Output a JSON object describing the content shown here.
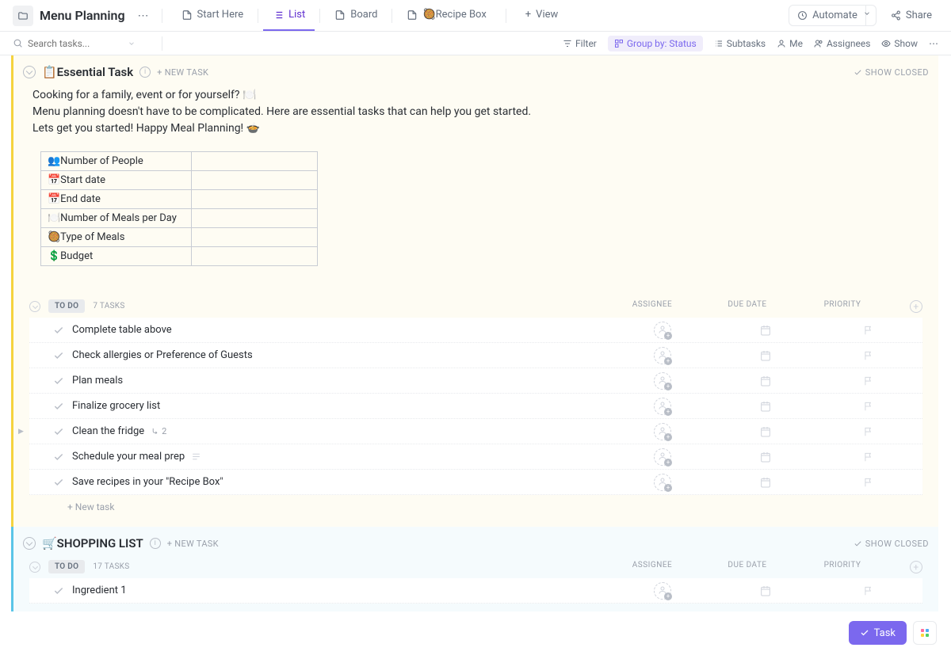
{
  "header": {
    "title": "Menu Planning",
    "tabs": [
      {
        "label": "Start Here",
        "icon": "doc"
      },
      {
        "label": "List",
        "icon": "list",
        "active": true
      },
      {
        "label": "Board",
        "icon": "doc"
      },
      {
        "label": "🥘Recipe Box",
        "icon": "doc"
      }
    ],
    "view_btn": "View",
    "automate": "Automate",
    "share": "Share"
  },
  "toolbar": {
    "search_placeholder": "Search tasks...",
    "filter": "Filter",
    "group_by": "Group by: Status",
    "subtasks": "Subtasks",
    "me": "Me",
    "assignees": "Assignees",
    "show": "Show"
  },
  "sections": [
    {
      "title": "📋Essential Task",
      "color": "yellow",
      "new_task": "+ NEW TASK",
      "show_closed": "SHOW CLOSED",
      "description": [
        "Cooking for a family, event or for yourself? 🍽️",
        "Menu planning doesn't have to be complicated. Here are essential tasks that can help you get started.",
        "Lets get you started! Happy Meal Planning! 🍲"
      ],
      "info_rows": [
        "👥Number of People",
        "📅Start date",
        "📅End date",
        "🍽️Number of Meals per Day",
        "🥘Type of Meals",
        "💲Budget"
      ],
      "groups": [
        {
          "status": "TO DO",
          "count": "7 TASKS",
          "columns": [
            "ASSIGNEE",
            "DUE DATE",
            "PRIORITY"
          ],
          "tasks": [
            {
              "name": "Complete table above"
            },
            {
              "name": "Check allergies or Preference of Guests"
            },
            {
              "name": "Plan meals"
            },
            {
              "name": "Finalize grocery list"
            },
            {
              "name": "Clean the fridge",
              "subtasks": "2",
              "expandable": true
            },
            {
              "name": "Schedule your meal prep",
              "has_desc": true
            },
            {
              "name": "Save recipes in your \"Recipe Box\""
            }
          ],
          "new_task": "+ New task"
        }
      ]
    },
    {
      "title": "🛒SHOPPING LIST",
      "color": "blue",
      "new_task": "+ NEW TASK",
      "show_closed": "SHOW CLOSED",
      "groups": [
        {
          "status": "TO DO",
          "count": "17 TASKS",
          "columns": [
            "ASSIGNEE",
            "DUE DATE",
            "PRIORITY"
          ],
          "tasks": [
            {
              "name": "Ingredient 1"
            }
          ]
        }
      ]
    }
  ],
  "float": {
    "task": "Task"
  }
}
